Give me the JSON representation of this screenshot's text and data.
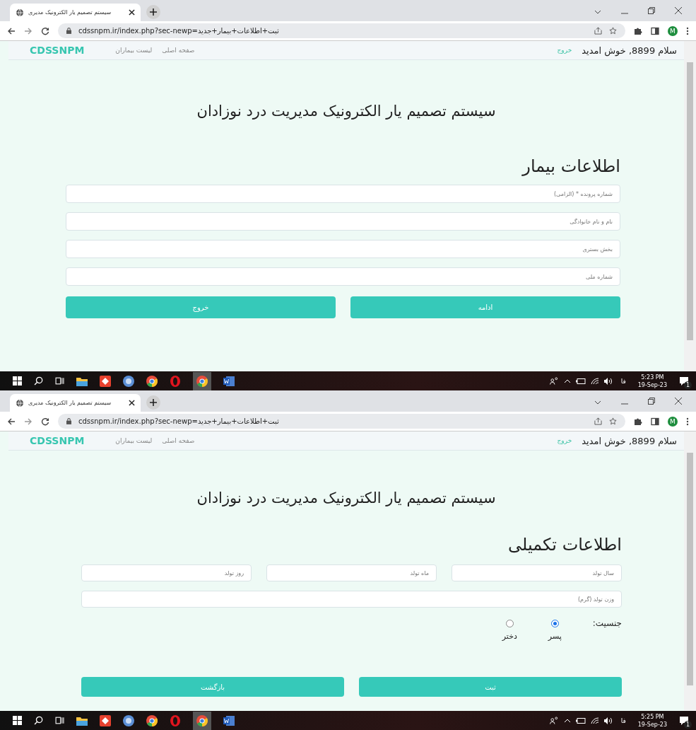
{
  "screens": [
    {
      "browser": {
        "tab_title": "سیستم تصمیم یار الکترونیک مدیری",
        "url": "cdssnpm.ir/index.php?sec-newp=ثبت+اطلاعات+بیمار+جدید",
        "profile": "M"
      },
      "navbar": {
        "brand": "CDSSNPM",
        "links": [
          "صفحه اصلی",
          "لیست بیماران"
        ],
        "logout": "خروج",
        "greeting": "سلام 8899, خوش امدید"
      },
      "page_title": "سیستم تصمیم یار الکترونیک مدیریت درد نوزادان",
      "section_title": "اطلاعات بیمار",
      "form": {
        "rows": [
          [
            {
              "placeholder": "شماره پرونده * (الزامی)"
            }
          ],
          [
            {
              "placeholder": "نام و نام خانوادگی"
            }
          ],
          [
            {
              "placeholder": "بخش بستری"
            }
          ],
          [
            {
              "placeholder": "شماره ملی"
            }
          ]
        ],
        "buttons": [
          "ادامه",
          "خروج"
        ]
      },
      "taskbar": {
        "language": "فا",
        "time": "5:23 PM",
        "date": "19-Sep-23",
        "notifications": "1"
      }
    },
    {
      "browser": {
        "tab_title": "سیستم تصمیم یار الکترونیک مدیری",
        "url": "cdssnpm.ir/index.php?sec-newp=ثبت+اطلاعات+بیمار+جدید",
        "profile": "M"
      },
      "navbar": {
        "brand": "CDSSNPM",
        "links": [
          "صفحه اصلی",
          "لیست بیماران"
        ],
        "logout": "خروج",
        "greeting": "سلام 8899, خوش امدید"
      },
      "page_title": "سیستم تصمیم یار الکترونیک مدیریت درد نوزادان",
      "section_title": "اطلاعات تکمیلی",
      "form": {
        "rows": [
          [
            {
              "placeholder": "سال تولد"
            },
            {
              "placeholder": "ماه تولد"
            },
            {
              "placeholder": "روز تولد"
            }
          ],
          [
            {
              "placeholder": "وزن تولد (گرم)"
            }
          ]
        ],
        "gender": {
          "label": "جنسیت:",
          "options": [
            {
              "label": "پسر",
              "selected": true
            },
            {
              "label": "دختر",
              "selected": false
            }
          ]
        },
        "buttons": [
          "ثبت",
          "بازگشت"
        ]
      },
      "taskbar": {
        "language": "فا",
        "time": "5:25 PM",
        "date": "19-Sep-23",
        "notifications": "1"
      }
    }
  ]
}
